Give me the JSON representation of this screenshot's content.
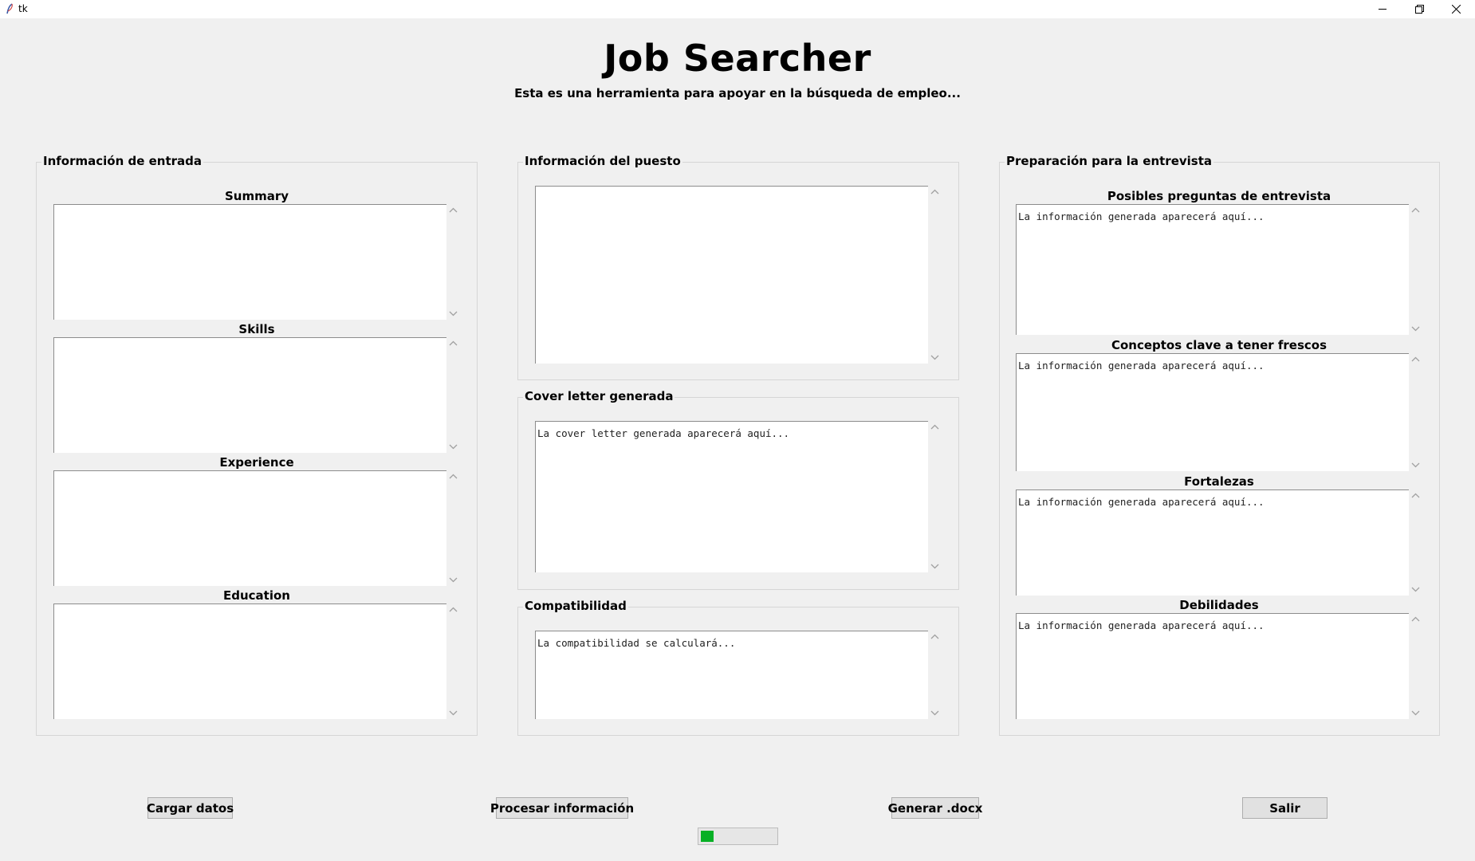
{
  "window": {
    "title": "tk"
  },
  "header": {
    "title": "Job Searcher",
    "subtitle": "Esta es una herramienta para apoyar en la búsqueda de empleo..."
  },
  "input_frame": {
    "label": "Información de entrada",
    "fields": [
      {
        "label": "Summary",
        "value": ""
      },
      {
        "label": "Skills",
        "value": ""
      },
      {
        "label": "Experience",
        "value": ""
      },
      {
        "label": "Education",
        "value": ""
      }
    ]
  },
  "job_frame": {
    "label": "Información del puesto",
    "value": ""
  },
  "cover_frame": {
    "label": "Cover letter generada",
    "value": "La cover letter generada aparecerá aquí..."
  },
  "compat_frame": {
    "label": "Compatibilidad",
    "value": "La compatibilidad se calculará..."
  },
  "interview_frame": {
    "label": "Preparación para la entrevista",
    "fields": [
      {
        "label": "Posibles preguntas de entrevista",
        "value": "La información generada aparecerá aquí..."
      },
      {
        "label": "Conceptos clave a tener frescos",
        "value": "La información generada aparecerá aquí..."
      },
      {
        "label": "Fortalezas",
        "value": "La información generada aparecerá aquí..."
      },
      {
        "label": "Debilidades",
        "value": "La información generada aparecerá aquí..."
      }
    ]
  },
  "buttons": {
    "load": "Cargar datos",
    "process": "Procesar información",
    "generate": "Generar .docx",
    "exit": "Salir"
  },
  "progress": {
    "value": 0.17
  },
  "colors": {
    "background": "#f0f0f0",
    "progress_fill": "#06b025"
  },
  "icons": {
    "app": "tk-feather-icon",
    "minimize": "minimize-icon",
    "restore": "restore-icon",
    "close": "close-icon"
  }
}
